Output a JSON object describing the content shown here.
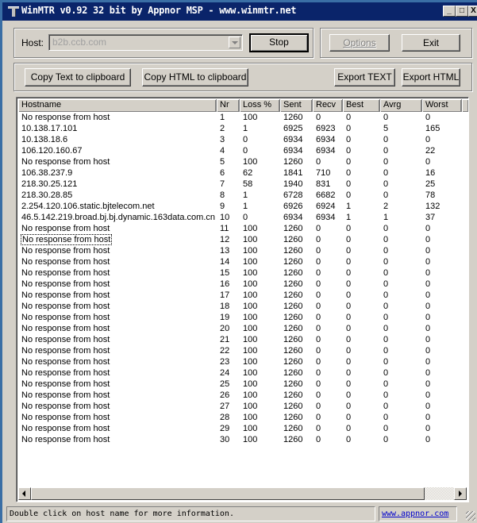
{
  "window": {
    "title": "WinMTR v0.92 32 bit by Appnor MSP - www.winmtr.net",
    "controls": {
      "minimize": "_",
      "maximize": "□",
      "close": "X"
    }
  },
  "host": {
    "label": "Host:",
    "value": "b2b.ccb.com"
  },
  "buttons": {
    "stop": "Stop",
    "options": "Options",
    "exit": "Exit",
    "copy_text": "Copy Text to clipboard",
    "copy_html": "Copy HTML to clipboard",
    "export_text": "Export TEXT",
    "export_html": "Export HTML"
  },
  "table": {
    "columns": [
      "Hostname",
      "Nr",
      "Loss %",
      "Sent",
      "Recv",
      "Best",
      "Avrg",
      "Worst"
    ],
    "focused_row": 12,
    "rows": [
      [
        "No response from host",
        "1",
        "100",
        "1260",
        "0",
        "0",
        "0",
        "0"
      ],
      [
        "10.138.17.101",
        "2",
        "1",
        "6925",
        "6923",
        "0",
        "5",
        "165"
      ],
      [
        "10.138.18.6",
        "3",
        "0",
        "6934",
        "6934",
        "0",
        "0",
        "0"
      ],
      [
        "106.120.160.67",
        "4",
        "0",
        "6934",
        "6934",
        "0",
        "0",
        "22"
      ],
      [
        "No response from host",
        "5",
        "100",
        "1260",
        "0",
        "0",
        "0",
        "0"
      ],
      [
        "106.38.237.9",
        "6",
        "62",
        "1841",
        "710",
        "0",
        "0",
        "16"
      ],
      [
        "218.30.25.121",
        "7",
        "58",
        "1940",
        "831",
        "0",
        "0",
        "25"
      ],
      [
        "218.30.28.85",
        "8",
        "1",
        "6728",
        "6682",
        "0",
        "0",
        "78"
      ],
      [
        "2.254.120.106.static.bjtelecom.net",
        "9",
        "1",
        "6926",
        "6924",
        "1",
        "2",
        "132"
      ],
      [
        "46.5.142.219.broad.bj.bj.dynamic.163data.com.cn",
        "10",
        "0",
        "6934",
        "6934",
        "1",
        "1",
        "37"
      ],
      [
        "No response from host",
        "11",
        "100",
        "1260",
        "0",
        "0",
        "0",
        "0"
      ],
      [
        "No response from host",
        "12",
        "100",
        "1260",
        "0",
        "0",
        "0",
        "0"
      ],
      [
        "No response from host",
        "13",
        "100",
        "1260",
        "0",
        "0",
        "0",
        "0"
      ],
      [
        "No response from host",
        "14",
        "100",
        "1260",
        "0",
        "0",
        "0",
        "0"
      ],
      [
        "No response from host",
        "15",
        "100",
        "1260",
        "0",
        "0",
        "0",
        "0"
      ],
      [
        "No response from host",
        "16",
        "100",
        "1260",
        "0",
        "0",
        "0",
        "0"
      ],
      [
        "No response from host",
        "17",
        "100",
        "1260",
        "0",
        "0",
        "0",
        "0"
      ],
      [
        "No response from host",
        "18",
        "100",
        "1260",
        "0",
        "0",
        "0",
        "0"
      ],
      [
        "No response from host",
        "19",
        "100",
        "1260",
        "0",
        "0",
        "0",
        "0"
      ],
      [
        "No response from host",
        "20",
        "100",
        "1260",
        "0",
        "0",
        "0",
        "0"
      ],
      [
        "No response from host",
        "21",
        "100",
        "1260",
        "0",
        "0",
        "0",
        "0"
      ],
      [
        "No response from host",
        "22",
        "100",
        "1260",
        "0",
        "0",
        "0",
        "0"
      ],
      [
        "No response from host",
        "23",
        "100",
        "1260",
        "0",
        "0",
        "0",
        "0"
      ],
      [
        "No response from host",
        "24",
        "100",
        "1260",
        "0",
        "0",
        "0",
        "0"
      ],
      [
        "No response from host",
        "25",
        "100",
        "1260",
        "0",
        "0",
        "0",
        "0"
      ],
      [
        "No response from host",
        "26",
        "100",
        "1260",
        "0",
        "0",
        "0",
        "0"
      ],
      [
        "No response from host",
        "27",
        "100",
        "1260",
        "0",
        "0",
        "0",
        "0"
      ],
      [
        "No response from host",
        "28",
        "100",
        "1260",
        "0",
        "0",
        "0",
        "0"
      ],
      [
        "No response from host",
        "29",
        "100",
        "1260",
        "0",
        "0",
        "0",
        "0"
      ],
      [
        "No response from host",
        "30",
        "100",
        "1260",
        "0",
        "0",
        "0",
        "0"
      ]
    ]
  },
  "status": {
    "message": "Double click on host name for more information.",
    "link": "www.appnor.com"
  }
}
